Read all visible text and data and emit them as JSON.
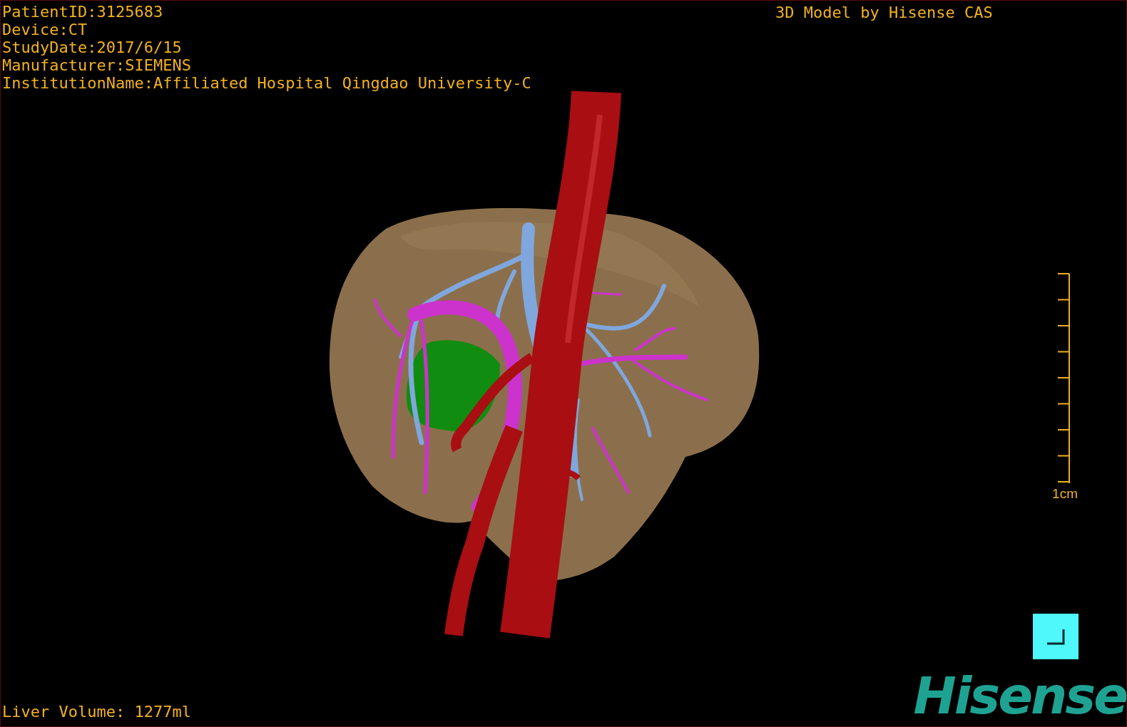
{
  "patient_info": [
    "PatientID:3125683",
    "Device:CT",
    "StudyDate:2017/6/15",
    "Manufacturer:SIEMENS",
    "InstitutionName:Affiliated Hospital Qingdao University-C"
  ],
  "credit": "3D Model by Hisense CAS",
  "scale_bar": {
    "label": "1cm"
  },
  "liver_volume": "Liver Volume: 1277ml",
  "logo": "Hisense"
}
